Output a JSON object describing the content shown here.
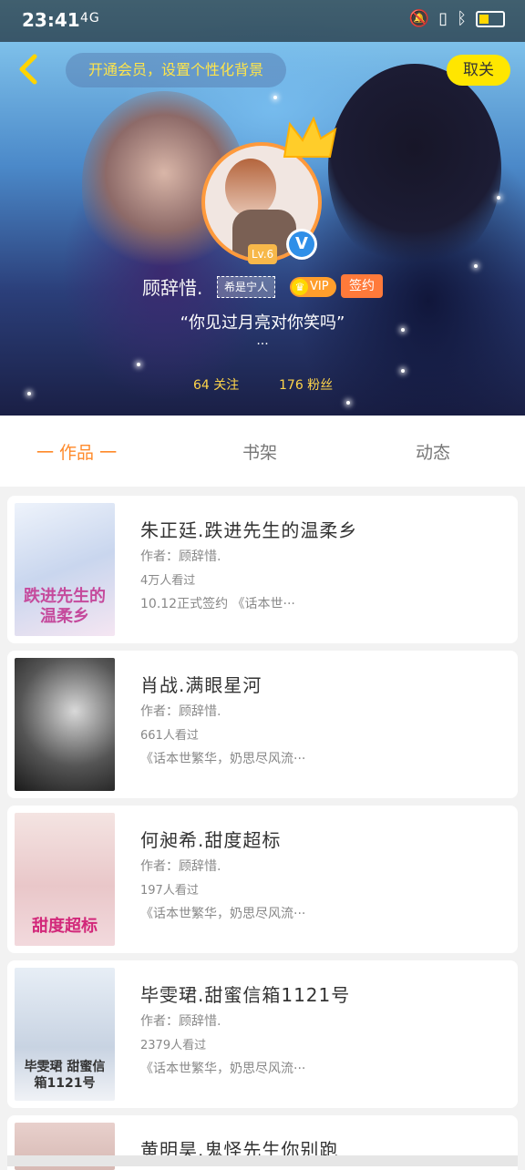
{
  "status_bar": {
    "time": "23:41",
    "signal": "4G"
  },
  "header": {
    "vip_banner": "开通会员，设置个性化背景",
    "cancel_label": "取关",
    "level_badge": "Lv.6",
    "verify_mark": "V",
    "username": "顾辞惜.",
    "username_tag": "希是宁人",
    "vip_label": "VIP",
    "signed_label": "签约",
    "motto": "“你见过月亮对你笑吗”",
    "motto_more": "···",
    "follow": "64 关注",
    "fans": "176 粉丝"
  },
  "tabs": [
    {
      "label": "一 作品 一",
      "active": true
    },
    {
      "label": "书架",
      "active": false
    },
    {
      "label": "动态",
      "active": false
    }
  ],
  "works": [
    {
      "title": "朱正廷.跌进先生的温柔乡",
      "author": "作者：顾辞惜.",
      "reads": "4万人看过",
      "desc": "10.12正式签约  《话本世···",
      "cover_text": "跌进先生的温柔乡"
    },
    {
      "title": "肖战.满眼星河",
      "author": "作者：顾辞惜.",
      "reads": "661人看过",
      "desc": "《话本世繁华，奶思尽风流···",
      "cover_text": ""
    },
    {
      "title": "何昶希.甜度超标",
      "author": "作者：顾辞惜.",
      "reads": "197人看过",
      "desc": "《话本世繁华，奶思尽风流···",
      "cover_text": "甜度超标"
    },
    {
      "title": "毕雯珺.甜蜜信箱1121号",
      "author": "作者：顾辞惜.",
      "reads": "2379人看过",
      "desc": "《话本世繁华，奶思尽风流···",
      "cover_text": "毕雯珺 甜蜜信箱1121号"
    },
    {
      "title": "黄明昊.鬼怪先生你别跑",
      "author": "",
      "reads": "",
      "desc": "",
      "cover_text": ""
    }
  ],
  "colors": {
    "accent": "#ff8a2a",
    "yellow": "#ffe600",
    "vip_orange": "#ff9e2c",
    "verify_blue": "#2f8fe8"
  }
}
